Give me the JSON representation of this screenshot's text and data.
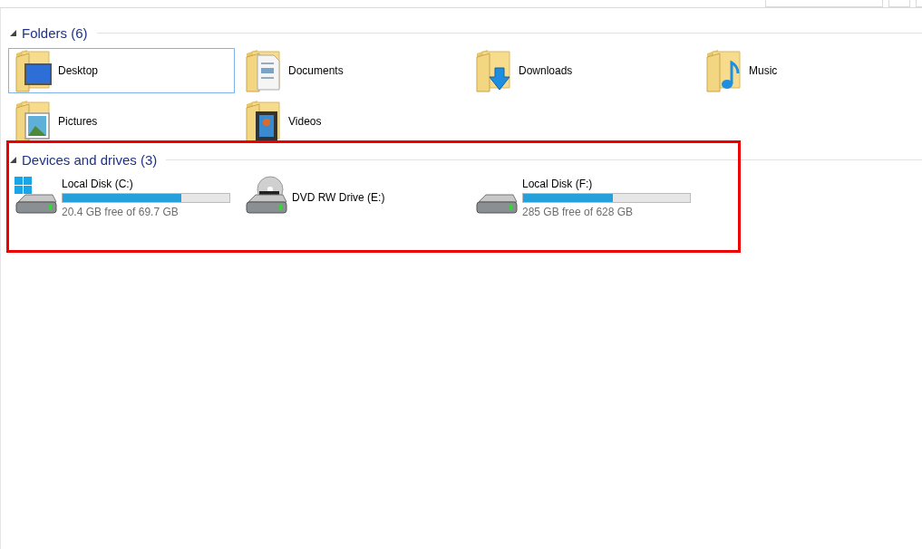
{
  "sections": [
    {
      "title": "Folders (6)",
      "expanded": true,
      "highlighted": false,
      "items": [
        {
          "kind": "folder",
          "name": "Desktop",
          "selected": true
        },
        {
          "kind": "folder",
          "name": "Documents",
          "selected": false
        },
        {
          "kind": "folder",
          "name": "Downloads",
          "selected": false
        },
        {
          "kind": "folder",
          "name": "Music",
          "selected": false
        },
        {
          "kind": "folder",
          "name": "Pictures",
          "selected": false
        },
        {
          "kind": "folder",
          "name": "Videos",
          "selected": false
        }
      ]
    },
    {
      "title": "Devices and drives (3)",
      "expanded": true,
      "highlighted": true,
      "items": [
        {
          "kind": "disk",
          "name": "Local Disk (C:)",
          "selected": false,
          "level": 0.71,
          "free": "20.4 GB free of 69.7 GB"
        },
        {
          "kind": "optical",
          "name": "DVD RW Drive (E:)",
          "selected": false
        },
        {
          "kind": "disk",
          "name": "Local Disk (F:)",
          "selected": false,
          "level": 0.54,
          "free": "285 GB free of 628 GB"
        }
      ]
    }
  ]
}
